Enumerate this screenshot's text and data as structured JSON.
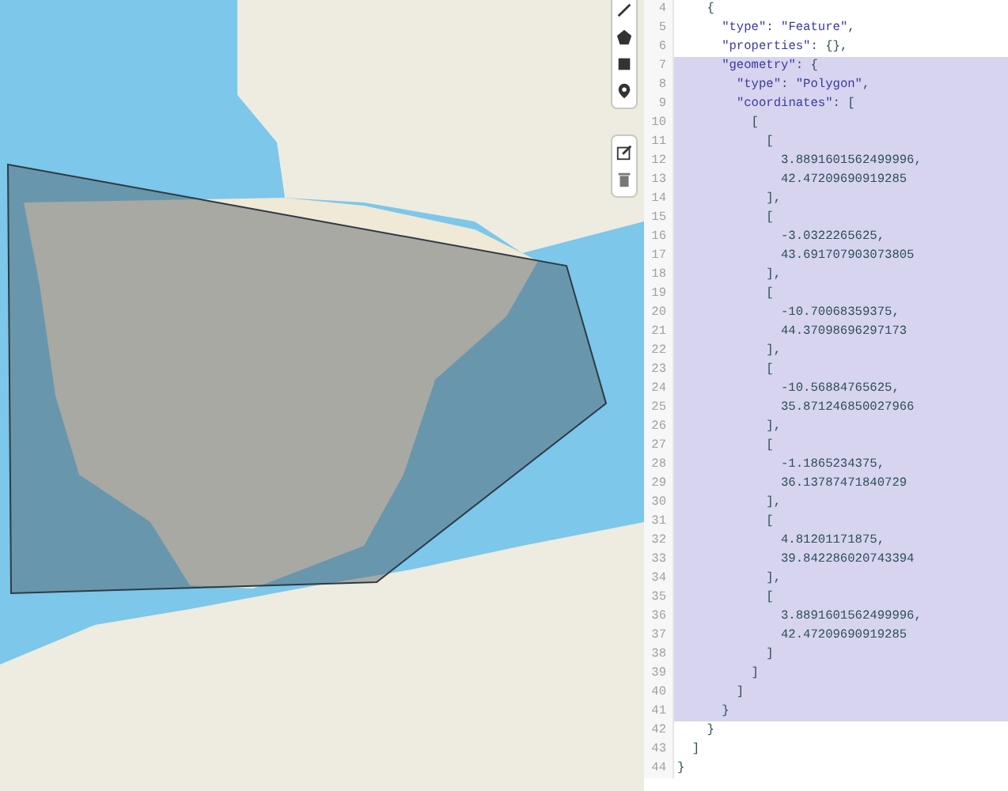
{
  "map": {
    "toolbar": [
      {
        "kind": "line"
      },
      {
        "kind": "polygon"
      },
      {
        "kind": "rectangle"
      },
      {
        "kind": "marker"
      },
      {
        "kind": "edit"
      },
      {
        "kind": "delete"
      }
    ]
  },
  "editor": {
    "lines": [
      {
        "number": "4",
        "text": "    {",
        "selected": false
      },
      {
        "number": "5",
        "text": "      \"type\": \"Feature\",",
        "selected": false
      },
      {
        "number": "6",
        "text": "      \"properties\": {},",
        "selected": false
      },
      {
        "number": "7",
        "text": "      \"geometry\": {",
        "selected": true
      },
      {
        "number": "8",
        "text": "        \"type\": \"Polygon\",",
        "selected": true
      },
      {
        "number": "9",
        "text": "        \"coordinates\": [",
        "selected": true
      },
      {
        "number": "10",
        "text": "          [",
        "selected": true
      },
      {
        "number": "11",
        "text": "            [",
        "selected": true
      },
      {
        "number": "12",
        "text": "              3.8891601562499996,",
        "selected": true
      },
      {
        "number": "13",
        "text": "              42.47209690919285",
        "selected": true
      },
      {
        "number": "14",
        "text": "            ],",
        "selected": true
      },
      {
        "number": "15",
        "text": "            [",
        "selected": true
      },
      {
        "number": "16",
        "text": "              -3.0322265625,",
        "selected": true
      },
      {
        "number": "17",
        "text": "              43.691707903073805",
        "selected": true
      },
      {
        "number": "18",
        "text": "            ],",
        "selected": true
      },
      {
        "number": "19",
        "text": "            [",
        "selected": true
      },
      {
        "number": "20",
        "text": "              -10.70068359375,",
        "selected": true
      },
      {
        "number": "21",
        "text": "              44.37098696297173",
        "selected": true
      },
      {
        "number": "22",
        "text": "            ],",
        "selected": true
      },
      {
        "number": "23",
        "text": "            [",
        "selected": true
      },
      {
        "number": "24",
        "text": "              -10.56884765625,",
        "selected": true
      },
      {
        "number": "25",
        "text": "              35.871246850027966",
        "selected": true
      },
      {
        "number": "26",
        "text": "            ],",
        "selected": true
      },
      {
        "number": "27",
        "text": "            [",
        "selected": true
      },
      {
        "number": "28",
        "text": "              -1.1865234375,",
        "selected": true
      },
      {
        "number": "29",
        "text": "              36.13787471840729",
        "selected": true
      },
      {
        "number": "30",
        "text": "            ],",
        "selected": true
      },
      {
        "number": "31",
        "text": "            [",
        "selected": true
      },
      {
        "number": "32",
        "text": "              4.81201171875,",
        "selected": true
      },
      {
        "number": "33",
        "text": "              39.842286020743394",
        "selected": true
      },
      {
        "number": "34",
        "text": "            ],",
        "selected": true
      },
      {
        "number": "35",
        "text": "            [",
        "selected": true
      },
      {
        "number": "36",
        "text": "              3.8891601562499996,",
        "selected": true
      },
      {
        "number": "37",
        "text": "              42.47209690919285",
        "selected": true
      },
      {
        "number": "38",
        "text": "            ]",
        "selected": true
      },
      {
        "number": "39",
        "text": "          ]",
        "selected": true
      },
      {
        "number": "40",
        "text": "        ]",
        "selected": true
      },
      {
        "number": "41",
        "text": "      }",
        "selected": true
      },
      {
        "number": "42",
        "text": "    }",
        "selected": false
      },
      {
        "number": "43",
        "text": "  ]",
        "selected": false
      },
      {
        "number": "44",
        "text": "}",
        "selected": false
      }
    ]
  }
}
